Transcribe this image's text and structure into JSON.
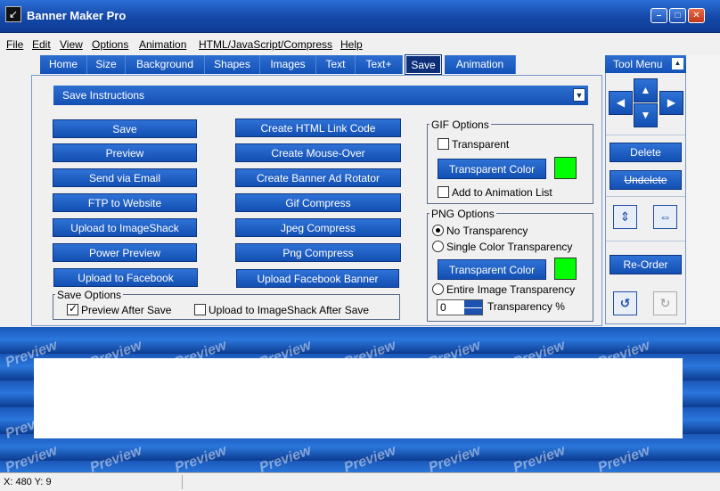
{
  "window": {
    "title": "Banner Maker Pro",
    "min": "–",
    "max": "□",
    "close": "✕"
  },
  "menu": [
    "File",
    "Edit",
    "View",
    "Options",
    "Animation",
    "HTML/JavaScript/Compress",
    "Help"
  ],
  "tabs": [
    "Home",
    "Size",
    "Background",
    "Shapes",
    "Images",
    "Text",
    "Text+",
    "Save",
    "Animation"
  ],
  "instructions": "Save Instructions",
  "left_buttons": [
    "Save",
    "Preview",
    "Send via Email",
    "FTP to Website",
    "Upload to ImageShack",
    "Power Preview",
    "Upload to Facebook"
  ],
  "mid_buttons": [
    "Create HTML Link Code",
    "Create Mouse-Over",
    "Create Banner Ad Rotator",
    "Gif Compress",
    "Jpeg Compress",
    "Png Compress",
    "Upload Facebook Banner"
  ],
  "save_options": {
    "label": "Save Options",
    "preview_after": "Preview After Save",
    "upload_after": "Upload to ImageShack After Save",
    "preview_after_checked": true,
    "upload_after_checked": false
  },
  "gif": {
    "label": "GIF Options",
    "transparent": "Transparent",
    "transparent_color": "Transparent Color",
    "add_to_animation": "Add to Animation List",
    "color": "#00ff00"
  },
  "png": {
    "label": "PNG Options",
    "no_transparency": "No Transparency",
    "single_color": "Single Color Transparency",
    "transparent_color": "Transparent Color",
    "entire_image": "Entire Image Transparency",
    "transparency_value": "0",
    "transparency_label": "Transparency %",
    "color": "#00ff00"
  },
  "tool_menu": {
    "title": "Tool Menu",
    "delete": "Delete",
    "undelete": "Undelete",
    "reorder": "Re-Order"
  },
  "preview_watermark": "Preview",
  "status": {
    "coords": "X: 480  Y: 9"
  }
}
